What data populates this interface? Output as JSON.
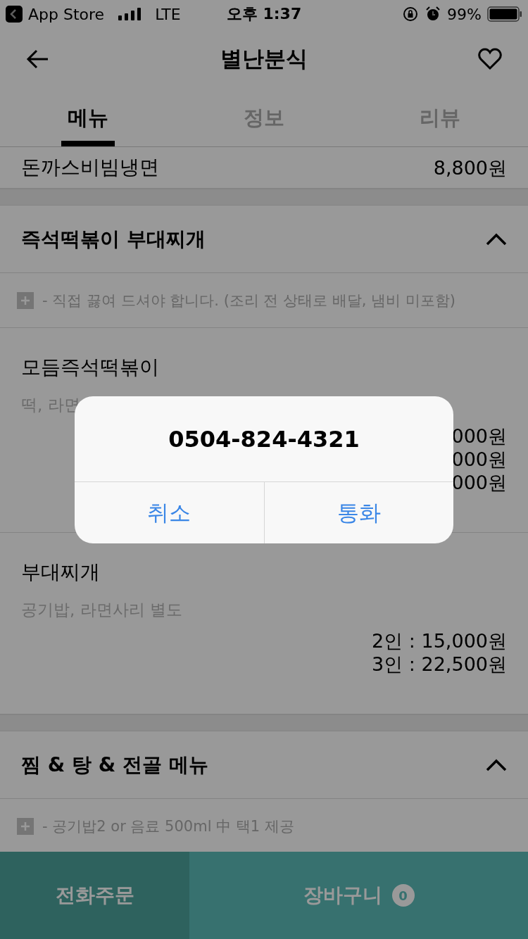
{
  "status_bar": {
    "back_app": "App Store",
    "network": "LTE",
    "time": "오후 1:37",
    "battery": "99%"
  },
  "header": {
    "title": "별난분식"
  },
  "tabs": [
    {
      "label": "메뉴",
      "selected": true
    },
    {
      "label": "정보",
      "selected": false
    },
    {
      "label": "리뷰",
      "selected": false
    }
  ],
  "menu_rows": [
    {
      "kind": "item",
      "name": "돈까스비빔냉면",
      "prices": [
        "8,800원"
      ]
    },
    {
      "kind": "section",
      "title": "즉석떡볶이 부대찌개",
      "expanded": true
    },
    {
      "kind": "note",
      "text": "- 직접 끓여 드셔야 합니다. (조리 전 상태로 배달, 냄비 미포함)"
    },
    {
      "kind": "item",
      "name": "모듬즉석떡볶이",
      "description": "떡, 라면",
      "prices": [
        "000원",
        "000원",
        "000원"
      ]
    },
    {
      "kind": "item",
      "name": "부대찌개",
      "description": "공기밥, 라면사리 별도",
      "prices": [
        "2인 : 15,000원",
        "3인 : 22,500원"
      ]
    },
    {
      "kind": "section",
      "title": "찜 & 탕 & 전골 메뉴",
      "expanded": true
    },
    {
      "kind": "note",
      "text": "- 공기밥2 or 음료 500ml 中 택1 제공"
    }
  ],
  "bottom_bar": {
    "phone_order": "전화주문",
    "cart": "장바구니",
    "cart_count": "0"
  },
  "dialog": {
    "title": "0504-824-4321",
    "buttons": [
      "취소",
      "통화"
    ]
  }
}
